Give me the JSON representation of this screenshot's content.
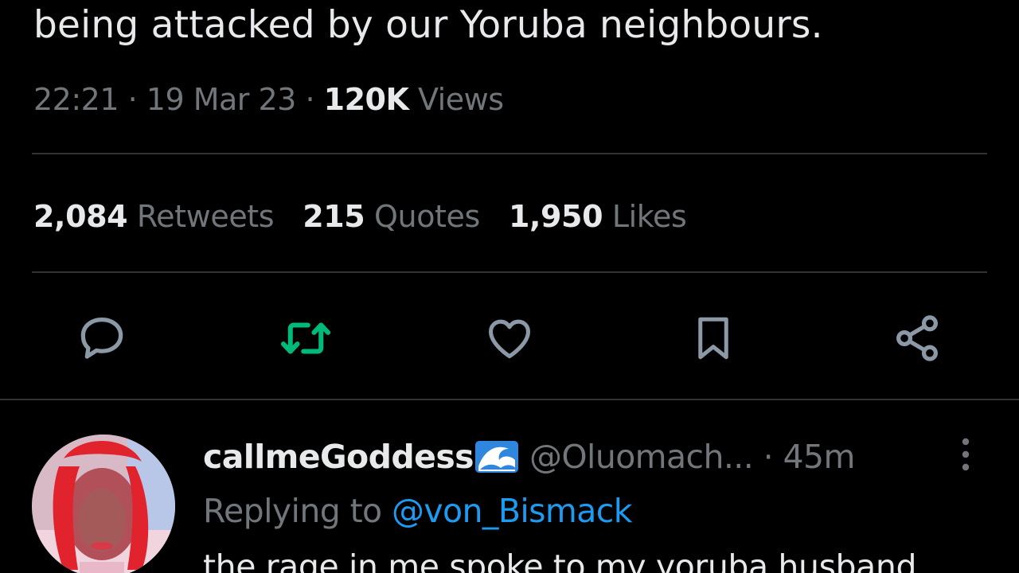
{
  "tweet": {
    "text_line": "being attacked by our Yoruba neighbours.",
    "time": "22:21",
    "separator": "·",
    "date": "19 Mar 23",
    "views_count": "120K",
    "views_label": "Views"
  },
  "stats": {
    "retweets_count": "2,084",
    "retweets_label": "Retweets",
    "quotes_count": "215",
    "quotes_label": "Quotes",
    "likes_count": "1,950",
    "likes_label": "Likes"
  },
  "actions": {
    "icons": [
      "reply-icon",
      "retweet-icon",
      "like-icon",
      "bookmark-icon",
      "share-icon"
    ],
    "retweet_active_color": "#00ba7c",
    "icon_color": "#8b98a5"
  },
  "reply": {
    "display_name": "callmeGoddess",
    "emoji_icon": "water-wave-emoji-icon",
    "handle": "@Oluomach...",
    "separator": "·",
    "time_ago": "45m",
    "replying_label": "Replying to",
    "replying_handle": "@von_Bismack",
    "body_text": "the rage in me spoke to my yoruba husband"
  },
  "colors": {
    "background": "#000000",
    "primary_text": "#e7e9ea",
    "secondary_text": "#71767b",
    "link": "#1d9bf0",
    "divider": "#2f3336"
  }
}
